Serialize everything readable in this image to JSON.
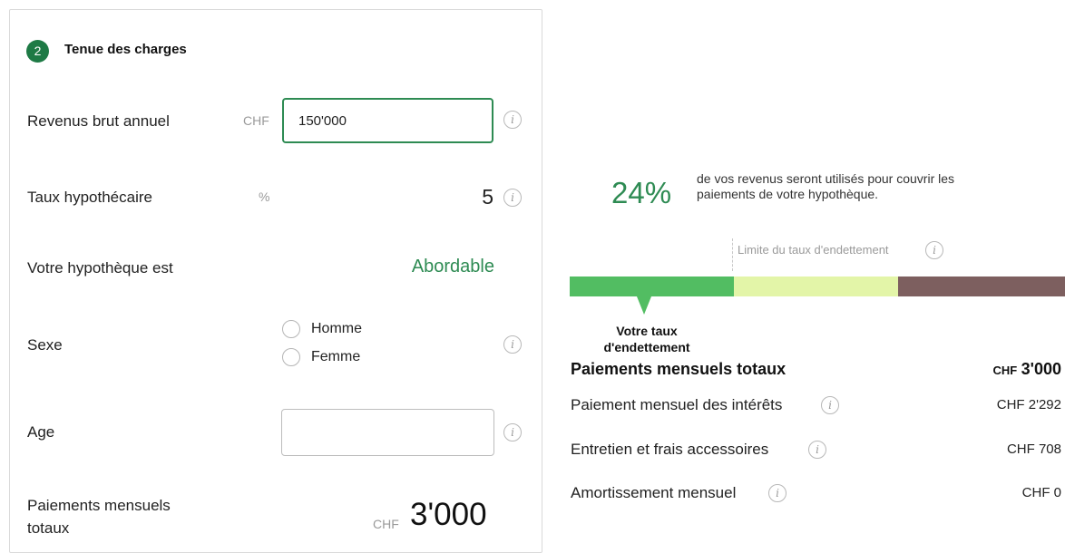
{
  "form": {
    "step_number": "2",
    "step_title": "Tenue des charges",
    "revenue": {
      "label": "Revenus brut annuel",
      "unit": "CHF",
      "value": "150'000"
    },
    "rate": {
      "label": "Taux hypothécaire",
      "unit": "%",
      "value": "5"
    },
    "affordability": {
      "label": "Votre hypothèque est",
      "value": "Abordable"
    },
    "sex": {
      "label": "Sexe",
      "options": [
        "Homme",
        "Femme"
      ]
    },
    "age": {
      "label": "Age",
      "value": ""
    },
    "total": {
      "label_line1": "Paiements mensuels",
      "label_line2": "totaux",
      "unit": "CHF",
      "value": "3'000"
    }
  },
  "summary": {
    "percentage": "24%",
    "description_line1": "de vos revenus seront utilisés pour couvrir les",
    "description_line2": "paiements de votre hypothèque.",
    "limit_label": "Limite du taux d'endettement",
    "pointer_label_line1": "Votre taux",
    "pointer_label_line2": "d'endettement",
    "bar_colors": [
      "#52bd62",
      "#e3f5a8",
      "#7d5f5f"
    ],
    "total": {
      "label": "Paiements mensuels totaux",
      "unit": "CHF",
      "value": "3'000"
    },
    "rows": [
      {
        "label": "Paiement mensuel des intérêts",
        "value": "CHF 2'292"
      },
      {
        "label": "Entretien et frais accessoires",
        "value": "CHF 708"
      },
      {
        "label": "Amortissement mensuel",
        "value": "CHF 0"
      }
    ]
  },
  "icons": {
    "info": "info-icon"
  },
  "colors": {
    "accent": "#2e8b53",
    "badge": "#1e7a45"
  }
}
